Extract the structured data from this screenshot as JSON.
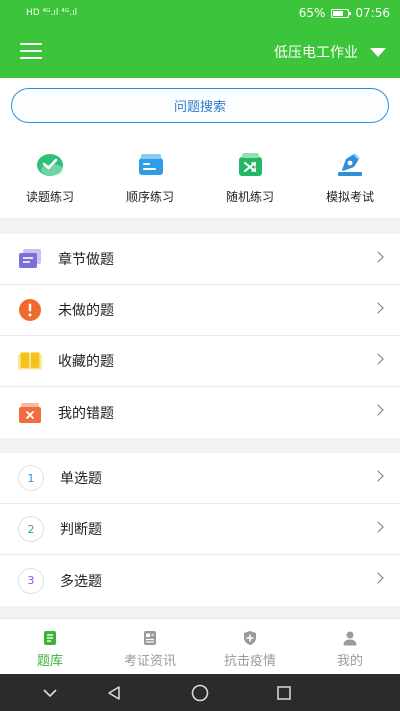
{
  "status_bar": {
    "left_indicators": "HD  ⁴ᴳ.ıl ⁴ᴳ.ıl",
    "battery": "65%",
    "time": "07:56"
  },
  "header": {
    "subject": "低压电工作业"
  },
  "search": {
    "label": "问题搜索"
  },
  "quick_actions": [
    {
      "label": "读题练习",
      "icon": "check-circle-icon",
      "color": "#2ec07a"
    },
    {
      "label": "顺序练习",
      "icon": "sequence-icon",
      "color": "#2f9ce8"
    },
    {
      "label": "随机练习",
      "icon": "shuffle-icon",
      "color": "#24b866"
    },
    {
      "label": "模拟考试",
      "icon": "pen-icon",
      "color": "#2f8fd8"
    }
  ],
  "menu_group_1": [
    {
      "label": "章节做题",
      "icon": "chapter-icon",
      "color": "#7b6fd8"
    },
    {
      "label": "未做的题",
      "icon": "exclamation-icon",
      "color": "#f06a2c"
    },
    {
      "label": "收藏的题",
      "icon": "book-icon",
      "color": "#f5c21c"
    },
    {
      "label": "我的错题",
      "icon": "wrong-box-icon",
      "color": "#f26d3d"
    }
  ],
  "menu_group_2": [
    {
      "label": "单选题",
      "number": "1",
      "color": "#2e8fd6"
    },
    {
      "label": "判断题",
      "number": "2",
      "color": "#29b06a"
    },
    {
      "label": "多选题",
      "number": "3",
      "color": "#a64fd8"
    }
  ],
  "tabs": [
    {
      "label": "题库",
      "icon": "question-bank-icon",
      "active": true
    },
    {
      "label": "考证资讯",
      "icon": "news-icon",
      "active": false
    },
    {
      "label": "抗击疫情",
      "icon": "shield-plus-icon",
      "active": false
    },
    {
      "label": "我的",
      "icon": "user-icon",
      "active": false
    }
  ],
  "colors": {
    "brand_green": "#3cc43a",
    "search_blue": "#2e8fd6"
  }
}
